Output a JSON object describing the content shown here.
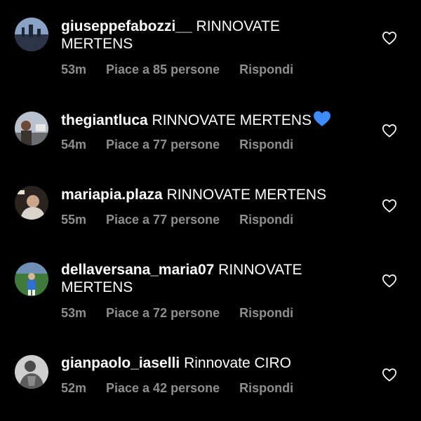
{
  "comments": [
    {
      "username": "giuseppefabozzi__",
      "text": "RINNOVATE MERTENS",
      "time": "53m",
      "likes": "Piace a 85 persone",
      "reply": "Rispondi",
      "avatar_color": "#3c4a66"
    },
    {
      "username": "thegiantluca",
      "text": "RINNOVATE MERTENS",
      "emoji": "blue-heart",
      "time": "54m",
      "likes": "Piace a 77 persone",
      "reply": "Rispondi",
      "avatar_color": "#9aa3ad"
    },
    {
      "username": "mariapia.plaza",
      "text": "RINNOVATE MERTENS",
      "time": "55m",
      "likes": "Piace a 77 persone",
      "reply": "Rispondi",
      "avatar_color": "#4a3a2e"
    },
    {
      "username": "dellaversana_maria07",
      "text": "RINNOVATE MERTENS",
      "time": "53m",
      "likes": "Piace a 72 persone",
      "reply": "Rispondi",
      "avatar_color": "#3f7a3a"
    },
    {
      "username": "gianpaolo_iaselli",
      "text": "Rinnovate CIRO",
      "time": "52m",
      "likes": "Piace a 42 persone",
      "reply": "Rispondi",
      "avatar_color": "#6e6e6e"
    }
  ],
  "icons": {
    "like": "heart-outline-icon",
    "emoji": "blue-heart-emoji"
  },
  "colors": {
    "background": "#000000",
    "text": "#ffffff",
    "meta": "#8e8e8e",
    "emoji_heart": "#3d8bff"
  }
}
